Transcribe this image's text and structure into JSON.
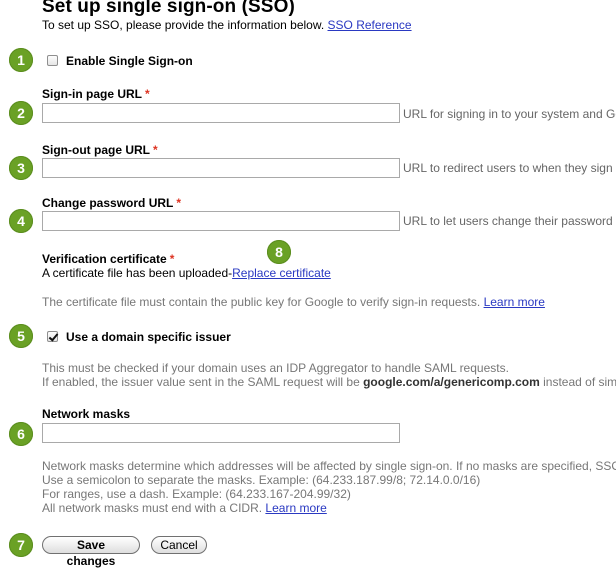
{
  "page": {
    "title": "Set up single sign-on (SSO)",
    "intro": "To set up SSO, please provide the information below.",
    "intro_link": "SSO Reference"
  },
  "badges": [
    "1",
    "2",
    "3",
    "4",
    "5",
    "6",
    "7",
    "8"
  ],
  "sso_enable": {
    "label": "Enable Single Sign-on",
    "checked": false
  },
  "sign_in": {
    "label": "Sign-in page URL",
    "required_mark": "*",
    "value": "",
    "hint": "URL for signing in to your system and Go"
  },
  "sign_out": {
    "label": "Sign-out page URL",
    "required_mark": "*",
    "value": "",
    "hint": "URL to redirect users to when they sign o"
  },
  "change_password": {
    "label": "Change password URL",
    "required_mark": "*",
    "value": "",
    "hint": "URL to let users change their password i"
  },
  "certificate": {
    "label": "Verification certificate",
    "required_mark": "*",
    "status": "A certificate file has been uploaded-",
    "replace_link": "Replace certificate",
    "note": "The certificate file must contain the public key for Google to verify sign-in requests.",
    "learn_more": "Learn more"
  },
  "domain_issuer": {
    "label": "Use a domain specific issuer",
    "checked": true,
    "note1": "This must be checked if your domain uses an IDP Aggregator to handle SAML requests.",
    "note2_pre": "If enabled, the issuer value sent in the SAML request will be ",
    "note2_bold": "google.com/a/genericomp.com",
    "note2_post": " instead of sim"
  },
  "network_masks": {
    "label": "Network masks",
    "value": "",
    "note1": "Network masks determine which addresses will be affected by single sign-on. If no masks are specified, SSO",
    "note2": "Use a semicolon to separate the masks. Example: (64.233.187.99/8; 72.14.0.0/16)",
    "note3": "For ranges, use a dash. Example: (64.233.167-204.99/32)",
    "note4": "All network masks must end with a CIDR.",
    "learn_more": "Learn more"
  },
  "actions": {
    "save": "Save changes",
    "cancel": "Cancel"
  },
  "colors": {
    "badge": "#6aa125",
    "link": "#2a39c2",
    "required": "#dd3322"
  }
}
